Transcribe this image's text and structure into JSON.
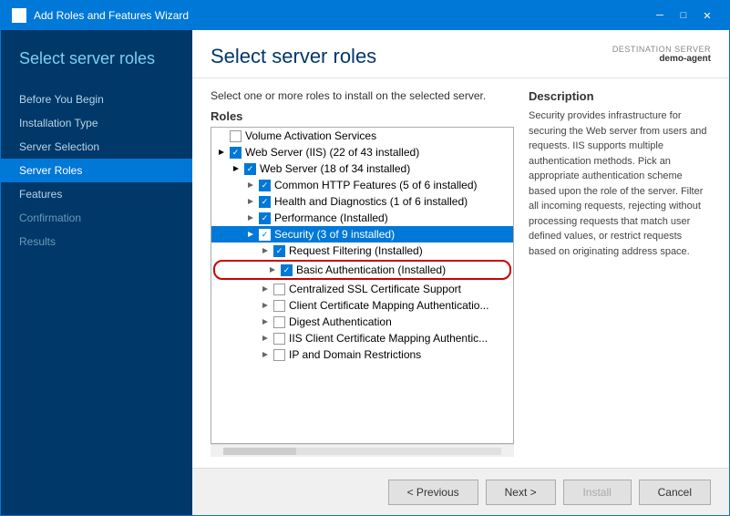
{
  "window": {
    "title": "Add Roles and Features Wizard",
    "icon": "⚙"
  },
  "titlebar": {
    "minimize": "─",
    "restore": "□",
    "close": "✕"
  },
  "sidebar": {
    "heading": "Select server roles",
    "items": [
      {
        "label": "Before You Begin",
        "state": "normal"
      },
      {
        "label": "Installation Type",
        "state": "normal"
      },
      {
        "label": "Server Selection",
        "state": "normal"
      },
      {
        "label": "Server Roles",
        "state": "active"
      },
      {
        "label": "Features",
        "state": "normal"
      },
      {
        "label": "Confirmation",
        "state": "dimmed"
      },
      {
        "label": "Results",
        "state": "dimmed"
      }
    ]
  },
  "main": {
    "title": "Select server roles",
    "destination_label": "DESTINATION SERVER",
    "destination_name": "demo-agent",
    "instruction": "Select one or more roles to install on the selected server.",
    "roles_label": "Roles",
    "description_title": "Description",
    "description_text": "Security provides infrastructure for securing the Web server from users and requests. IIS supports multiple authentication methods. Pick an appropriate authentication scheme based upon the role of the server. Filter all incoming requests, rejecting without processing requests that match user defined values, or restrict requests based on originating address space."
  },
  "roles": [
    {
      "indent": 0,
      "expand": false,
      "checked": false,
      "partial": false,
      "label": "Volume Activation Services",
      "selected": false
    },
    {
      "indent": 0,
      "expand": true,
      "checked": true,
      "partial": false,
      "label": "Web Server (IIS) (22 of 43 installed)",
      "selected": false
    },
    {
      "indent": 1,
      "expand": true,
      "checked": true,
      "partial": false,
      "label": "Web Server (18 of 34 installed)",
      "selected": false
    },
    {
      "indent": 2,
      "expand": false,
      "checked": true,
      "partial": false,
      "label": "Common HTTP Features (5 of 6 installed)",
      "selected": false
    },
    {
      "indent": 2,
      "expand": false,
      "checked": true,
      "partial": false,
      "label": "Health and Diagnostics (1 of 6 installed)",
      "selected": false
    },
    {
      "indent": 2,
      "expand": false,
      "checked": true,
      "partial": false,
      "label": "Performance (Installed)",
      "selected": false
    },
    {
      "indent": 2,
      "expand": true,
      "checked": true,
      "partial": false,
      "label": "Security (3 of 9 installed)",
      "selected": true
    },
    {
      "indent": 3,
      "expand": false,
      "checked": true,
      "partial": false,
      "label": "Request Filtering (Installed)",
      "selected": false,
      "highlighted": false
    },
    {
      "indent": 3,
      "expand": false,
      "checked": true,
      "partial": false,
      "label": "Basic Authentication (Installed)",
      "selected": false,
      "highlighted": true
    },
    {
      "indent": 3,
      "expand": false,
      "checked": false,
      "partial": false,
      "label": "Centralized SSL Certificate Support",
      "selected": false
    },
    {
      "indent": 3,
      "expand": false,
      "checked": false,
      "partial": false,
      "label": "Client Certificate Mapping Authenticatio...",
      "selected": false
    },
    {
      "indent": 3,
      "expand": false,
      "checked": false,
      "partial": false,
      "label": "Digest Authentication",
      "selected": false
    },
    {
      "indent": 3,
      "expand": false,
      "checked": false,
      "partial": false,
      "label": "IIS Client Certificate Mapping Authentic...",
      "selected": false
    },
    {
      "indent": 3,
      "expand": false,
      "checked": false,
      "partial": false,
      "label": "IP and Domain Restrictions",
      "selected": false
    }
  ],
  "footer": {
    "previous_label": "< Previous",
    "next_label": "Next >",
    "install_label": "Install",
    "cancel_label": "Cancel"
  }
}
